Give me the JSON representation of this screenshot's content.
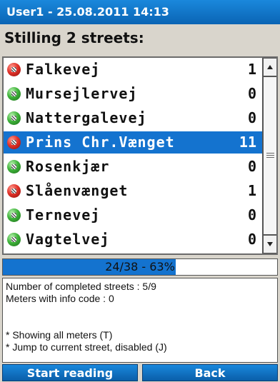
{
  "header": {
    "title": "User1 - 25.08.2011 14:13"
  },
  "heading": "Stilling 2 streets:",
  "streets": [
    {
      "name": "Falkevej",
      "count": "1",
      "status": "red"
    },
    {
      "name": "Mursejlervej",
      "count": "0",
      "status": "green"
    },
    {
      "name": "Nattergalevej",
      "count": "0",
      "status": "green"
    },
    {
      "name": "Prins Chr.Vænget",
      "count": "11",
      "status": "red",
      "selected": true
    },
    {
      "name": "Rosenkjær",
      "count": "0",
      "status": "green"
    },
    {
      "name": "Slåenvænget",
      "count": "1",
      "status": "red"
    },
    {
      "name": "Ternevej",
      "count": "0",
      "status": "green"
    },
    {
      "name": "Vagtelvej",
      "count": "0",
      "status": "green"
    }
  ],
  "progress": {
    "text": "24/38 - 63%",
    "fraction": 0.63
  },
  "info": {
    "line1": "Number of completed streets  : 5/9",
    "line2": "Meters with info code : 0",
    "line3": "* Showing all meters (T)",
    "line4": "* Jump to current street, disabled (J)"
  },
  "buttons": {
    "start": "Start reading",
    "back": "Back"
  },
  "colors": {
    "accent": "#1473cf",
    "status_red": "#e2332a",
    "status_green": "#3fb43a"
  }
}
